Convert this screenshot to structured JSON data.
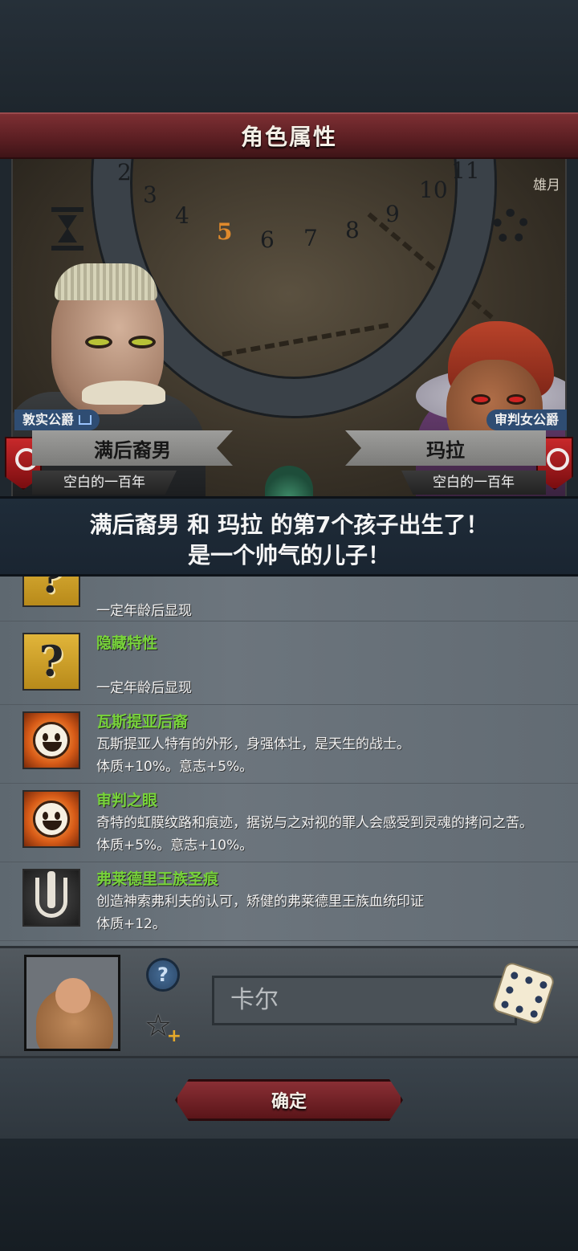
{
  "header": {
    "title": "角色属性"
  },
  "scene": {
    "timeline_numbers": [
      "2",
      "3",
      "4",
      "5",
      "6",
      "7",
      "8",
      "9",
      "10",
      "11"
    ],
    "active_number": "5",
    "corner_text": "雄月"
  },
  "father": {
    "rank": "敦实公爵",
    "name": "满后裔男",
    "era": "空白的一百年"
  },
  "mother": {
    "rank": "审判女公爵",
    "name": "玛拉",
    "era": "空白的一百年"
  },
  "announcement": {
    "line1": "满后裔男 和 玛拉 的第7个孩子出生了！",
    "line2": "是一个帅气的儿子！"
  },
  "traits": [
    {
      "name": "",
      "desc1": "一定年龄后显现",
      "desc2": ""
    },
    {
      "name": "隐藏特性",
      "desc1": "一定年龄后显现",
      "desc2": ""
    },
    {
      "name": "瓦斯提亚后裔",
      "desc1": "瓦斯提亚人特有的外形，身强体壮，是天生的战士。",
      "desc2": "体质+10%。意志+5%。"
    },
    {
      "name": "审判之眼",
      "desc1": "奇特的虹膜纹路和痕迹，据说与之对视的罪人会感受到灵魂的拷问之苦。",
      "desc2": "体质+5%。意志+10%。"
    },
    {
      "name": "弗莱德里王族圣痕",
      "desc1": "创造神索弗利夫的认可，矫健的弗莱德里王族血统印证",
      "desc2": "体质+12。"
    }
  ],
  "child": {
    "name_input": "卡尔",
    "help_label": "?"
  },
  "footer": {
    "confirm_label": "确定"
  },
  "colors": {
    "title_bar": "#7d2f33",
    "trait_name": "#77d33a",
    "rank_tag": "#2f4d73"
  }
}
